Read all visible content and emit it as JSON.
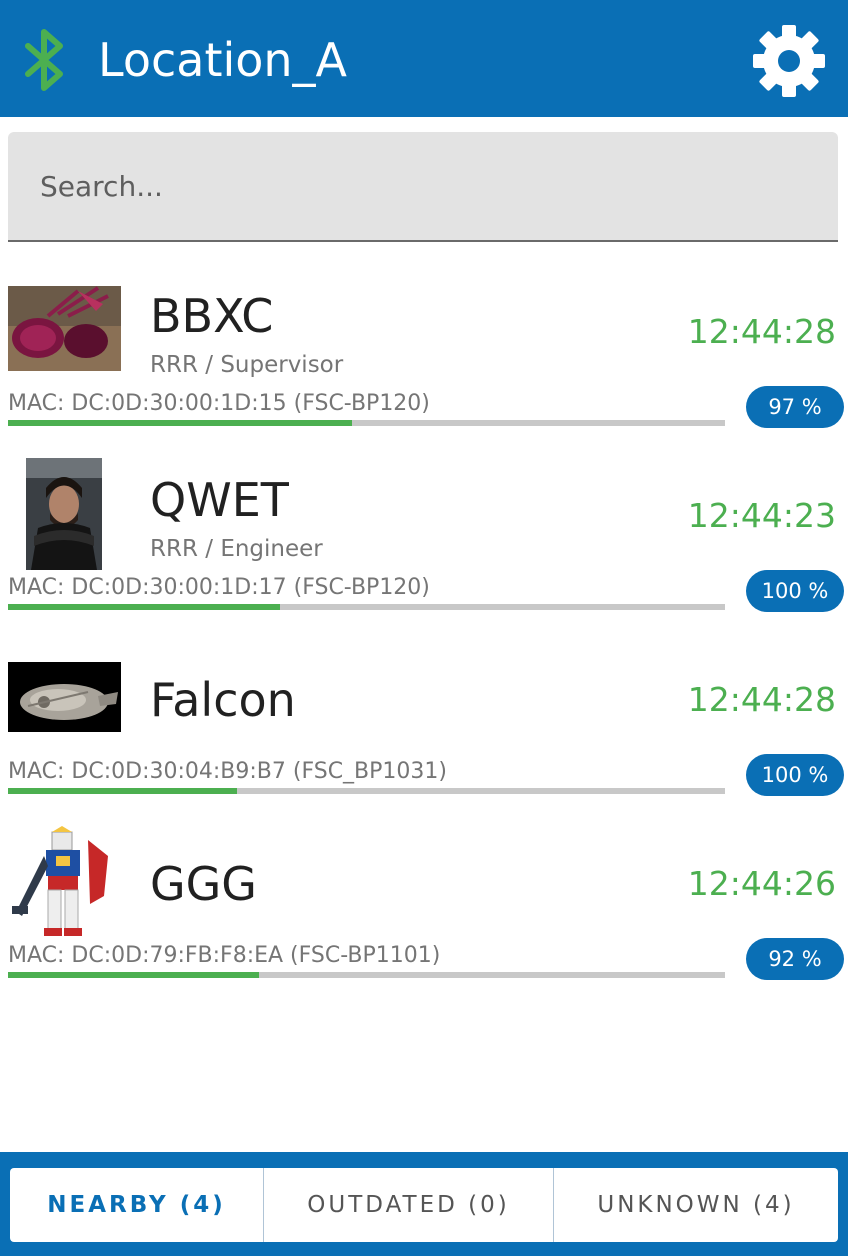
{
  "header": {
    "title": "Location_A",
    "bluetooth_icon": "bluetooth-icon",
    "settings_icon": "gear-icon",
    "bar_color": "#0a6fb5",
    "bluetooth_color": "#4caf50"
  },
  "search": {
    "placeholder": "Search..."
  },
  "devices": [
    {
      "name": "BBXC",
      "subtitle": "RRR / Supervisor",
      "time": "12:44:28",
      "mac": "MAC: DC:0D:30:00:1D:15 (FSC-BP120)",
      "battery": "97 %",
      "signal_fraction": 0.48,
      "thumbnail": "beet-photo"
    },
    {
      "name": "QWET",
      "subtitle": "RRR / Engineer",
      "time": "12:44:23",
      "mac": "MAC: DC:0D:30:00:1D:17 (FSC-BP120)",
      "battery": "100 %",
      "signal_fraction": 0.38,
      "thumbnail": "portrait-photo"
    },
    {
      "name": "Falcon",
      "subtitle": "",
      "time": "12:44:28",
      "mac": "MAC: DC:0D:30:04:B9:B7 (FSC_BP1031)",
      "battery": "100 %",
      "signal_fraction": 0.32,
      "thumbnail": "spaceship-photo"
    },
    {
      "name": "GGG",
      "subtitle": "",
      "time": "12:44:26",
      "mac": "MAC: DC:0D:79:FB:F8:EA (FSC-BP1101)",
      "battery": "92 %",
      "signal_fraction": 0.35,
      "thumbnail": "robot-figure-photo"
    }
  ],
  "tabs": [
    {
      "label": "NEARBY (4)",
      "active": true
    },
    {
      "label": "OUTDATED (0)",
      "active": false
    },
    {
      "label": "UNKNOWN (4)",
      "active": false
    }
  ],
  "colors": {
    "accent": "#0a6fb5",
    "time_green": "#4caf50",
    "progress_track": "#c8c8c8"
  }
}
